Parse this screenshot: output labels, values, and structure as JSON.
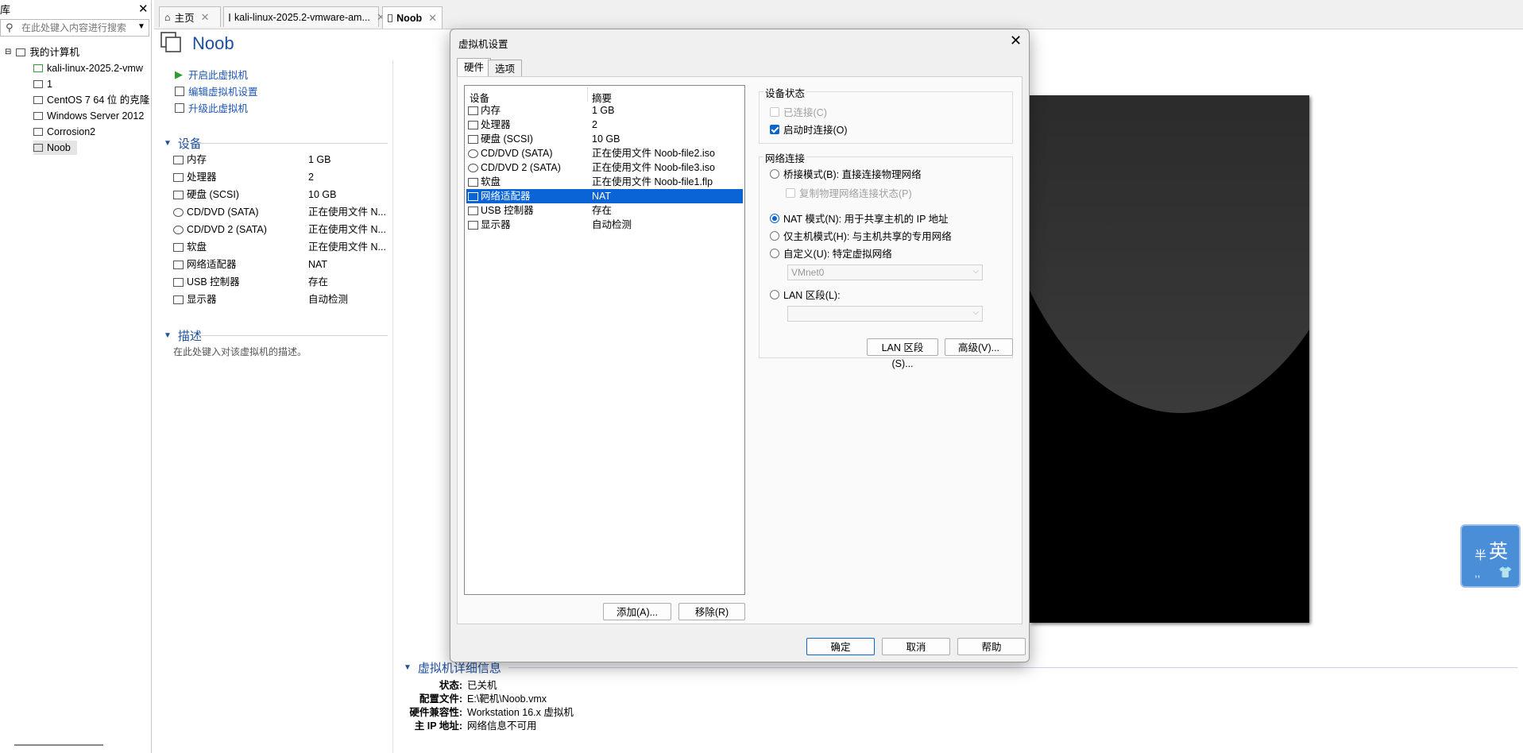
{
  "library": {
    "title": "库",
    "search_placeholder": "在此处键入内容进行搜索",
    "root": "我的计算机",
    "items": [
      "kali-linux-2025.2-vmw",
      "1",
      "CentOS 7 64 位 的克隆",
      "Windows Server 2012",
      "Corrosion2",
      "Noob"
    ]
  },
  "tabs": [
    {
      "label": "主页"
    },
    {
      "label": "kali-linux-2025.2-vmware-am..."
    },
    {
      "label": "Noob"
    }
  ],
  "vm": {
    "title": "Noob",
    "actions": [
      "开启此虚拟机",
      "编辑虚拟机设置",
      "升级此虚拟机"
    ],
    "devices_header": "设备",
    "devices": [
      {
        "name": "内存",
        "value": "1 GB"
      },
      {
        "name": "处理器",
        "value": "2"
      },
      {
        "name": "硬盘 (SCSI)",
        "value": "10 GB"
      },
      {
        "name": "CD/DVD (SATA)",
        "value": "正在使用文件 N..."
      },
      {
        "name": "CD/DVD 2 (SATA)",
        "value": "正在使用文件 N..."
      },
      {
        "name": "软盘",
        "value": "正在使用文件 N..."
      },
      {
        "name": "网络适配器",
        "value": "NAT"
      },
      {
        "name": "USB 控制器",
        "value": "存在"
      },
      {
        "name": "显示器",
        "value": "自动检测"
      }
    ],
    "desc_header": "描述",
    "desc_placeholder": "在此处键入对该虚拟机的描述。"
  },
  "details": {
    "header": "虚拟机详细信息",
    "rows": [
      {
        "k": "状态:",
        "v": "已关机"
      },
      {
        "k": "配置文件:",
        "v": "E:\\靶机\\Noob.vmx"
      },
      {
        "k": "硬件兼容性:",
        "v": "Workstation 16.x 虚拟机"
      },
      {
        "k": "主 IP 地址:",
        "v": "网络信息不可用"
      }
    ]
  },
  "ime": {
    "mode": "英",
    "half": "半",
    "punct": ",,"
  },
  "dialog": {
    "title": "虚拟机设置",
    "tabs": [
      "硬件",
      "选项"
    ],
    "list_headers": [
      "设备",
      "摘要"
    ],
    "hardware": [
      {
        "name": "内存",
        "summary": "1 GB"
      },
      {
        "name": "处理器",
        "summary": "2"
      },
      {
        "name": "硬盘 (SCSI)",
        "summary": "10 GB"
      },
      {
        "name": "CD/DVD (SATA)",
        "summary": "正在使用文件 Noob-file2.iso"
      },
      {
        "name": "CD/DVD 2 (SATA)",
        "summary": "正在使用文件 Noob-file3.iso"
      },
      {
        "name": "软盘",
        "summary": "正在使用文件 Noob-file1.flp"
      },
      {
        "name": "网络适配器",
        "summary": "NAT"
      },
      {
        "name": "USB 控制器",
        "summary": "存在"
      },
      {
        "name": "显示器",
        "summary": "自动检测"
      }
    ],
    "add_button": "添加(A)...",
    "remove_button": "移除(R)",
    "device_status": {
      "label": "设备状态",
      "connected": "已连接(C)",
      "connect_on_power": "启动时连接(O)"
    },
    "network": {
      "label": "网络连接",
      "bridged": "桥接模式(B): 直接连接物理网络",
      "replicate": "复制物理网络连接状态(P)",
      "nat": "NAT 模式(N): 用于共享主机的 IP 地址",
      "host_only": "仅主机模式(H): 与主机共享的专用网络",
      "custom": "自定义(U): 特定虚拟网络",
      "vmnet_value": "VMnet0",
      "lan": "LAN 区段(L):"
    },
    "lan_segments_button": "LAN 区段(S)...",
    "advanced_button": "高级(V)...",
    "ok_button": "确定",
    "cancel_button": "取消",
    "help_button": "帮助"
  }
}
